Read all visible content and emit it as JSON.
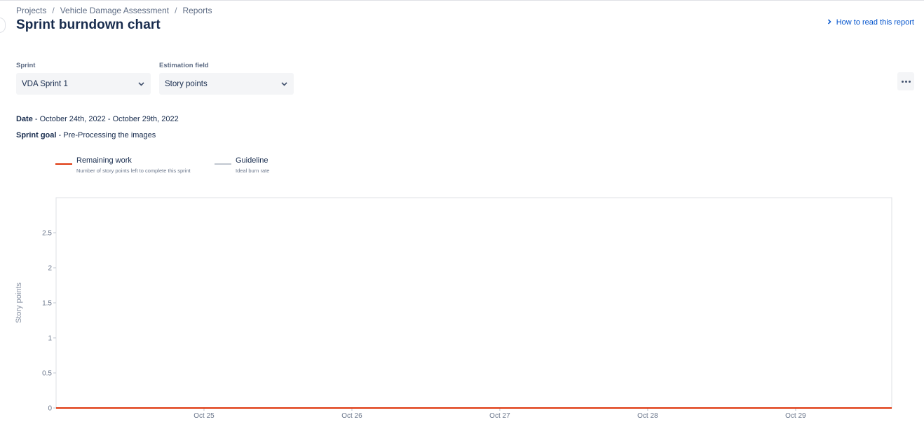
{
  "breadcrumb": {
    "items": [
      "Projects",
      "Vehicle Damage Assessment",
      "Reports"
    ],
    "separator": "/"
  },
  "header": {
    "title": "Sprint burndown chart",
    "help_link": "How to read this report"
  },
  "filters": {
    "sprint": {
      "label": "Sprint",
      "value": "VDA Sprint 1"
    },
    "estimation": {
      "label": "Estimation field",
      "value": "Story points"
    }
  },
  "sprint_info": {
    "date_label": "Date",
    "date_value": " - October 24th, 2022 - October 29th, 2022",
    "goal_label": "Sprint goal",
    "goal_value": " - Pre-Processing the images"
  },
  "legend": [
    {
      "name": "Remaining work",
      "description": "Number of story points left to complete this sprint",
      "color": "#de350b"
    },
    {
      "name": "Guideline",
      "description": "Ideal burn rate",
      "color": "#c1c7d0"
    }
  ],
  "chart_data": {
    "type": "line",
    "ylabel": "Story points",
    "xlabel": "",
    "ylim": [
      0,
      3
    ],
    "yticks": [
      0,
      0.5,
      1,
      1.5,
      2,
      2.5
    ],
    "ytick_labels": [
      "0",
      "0.5",
      "1",
      "1.5",
      "2",
      "2.5"
    ],
    "xticks": [
      "Oct 25",
      "Oct 26",
      "Oct 27",
      "Oct 28",
      "Oct 29"
    ],
    "xlim_days": [
      24.0,
      29.65
    ],
    "grid": false,
    "series": [
      {
        "name": "Remaining work",
        "color": "#de350b",
        "x_days": [
          24.0,
          29.65
        ],
        "values": [
          0,
          0
        ]
      }
    ]
  }
}
